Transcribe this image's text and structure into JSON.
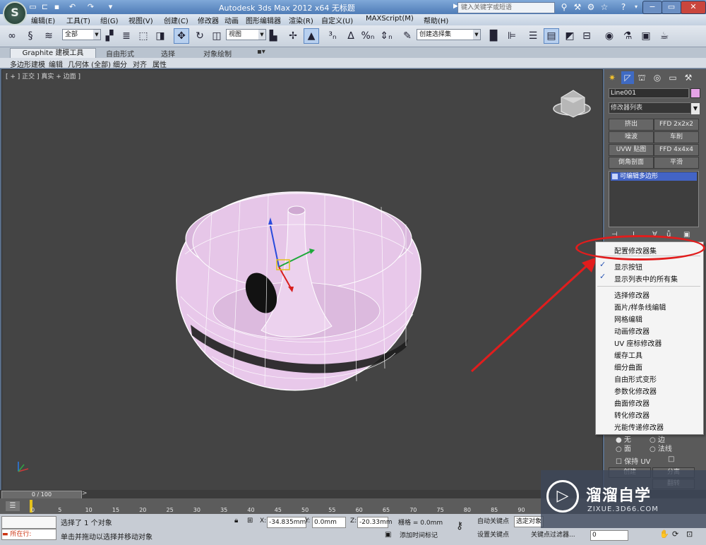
{
  "titlebar": {
    "title": "Autodesk 3ds Max  2012 x64     无标题",
    "search_placeholder": "键入关键字或短语",
    "logo": "S",
    "quick_access_icons": [
      "new-file-icon",
      "open-folder-icon",
      "save-icon",
      "undo-icon",
      "redo-icon",
      "dropdown-icon"
    ]
  },
  "menu": [
    "编辑(E)",
    "工具(T)",
    "组(G)",
    "视图(V)",
    "创建(C)",
    "修改器",
    "动画",
    "图形编辑器",
    "渲染(R)",
    "自定义(U)",
    "MAXScript(M)",
    "帮助(H)"
  ],
  "toolbar": {
    "selection_filter": "全部",
    "reference_coord": "视图",
    "named_selection": "创建选择集"
  },
  "ribbon": {
    "tabs": [
      "Graphite 建模工具",
      "自由形式",
      "选择",
      "对象绘制"
    ],
    "subtabs": [
      "多边形建模",
      "编辑",
      "几何体 (全部)",
      "细分",
      "对齐",
      "属性"
    ]
  },
  "viewport": {
    "label": "[ + ] 正交 ] 真实 + 边面 ]",
    "object_color": "#e8c8ea",
    "wire_color": "#ffffff"
  },
  "command_panel": {
    "object_name": "Line001",
    "object_color": "#e5a3e6",
    "modifier_list": "修改器列表",
    "modifier_buttons": [
      "挤出",
      "FFD 2x2x2",
      "噪波",
      "车削",
      "UVW 贴图",
      "FFD 4x4x4",
      "倒角剖面",
      "平滑"
    ],
    "stack_item": "可编辑多边形",
    "radio_options": [
      "无",
      "边",
      "面",
      "法线"
    ],
    "preserve_uv": "保持 UV",
    "btn_attach": "创建",
    "btn_split": "分离",
    "btn_flip": "翻转"
  },
  "context_menu": {
    "items": [
      {
        "label": "配置修改器集",
        "checked": false
      },
      {
        "label": "显示按钮",
        "checked": true
      },
      {
        "label": "显示列表中的所有集",
        "checked": true
      },
      {
        "label": "选择修改器",
        "checked": false
      },
      {
        "label": "面片/样条线编辑",
        "checked": false
      },
      {
        "label": "网格编辑",
        "checked": false
      },
      {
        "label": "动画修改器",
        "checked": false
      },
      {
        "label": "UV 座标修改器",
        "checked": false
      },
      {
        "label": "缓存工具",
        "checked": false
      },
      {
        "label": "细分曲面",
        "checked": false
      },
      {
        "label": "自由形式变形",
        "checked": false
      },
      {
        "label": "参数化修改器",
        "checked": false
      },
      {
        "label": "曲面修改器",
        "checked": false
      },
      {
        "label": "转化修改器",
        "checked": false
      },
      {
        "label": "光能传递修改器",
        "checked": false
      }
    ]
  },
  "timeline": {
    "frame": "0 / 100",
    "ticks": [
      "0",
      "5",
      "10",
      "15",
      "20",
      "25",
      "30",
      "35",
      "40",
      "45",
      "50",
      "55",
      "60",
      "65",
      "70",
      "75",
      "80",
      "85",
      "90"
    ]
  },
  "status": {
    "running_label": "所在行:",
    "selection": "选择了 1 个对象",
    "prompt": "单击并拖动以选择并移动对象",
    "x_label": "X:",
    "x": "-34.835mm",
    "y_label": "Y:",
    "y": "0.0mm",
    "z_label": "Z:",
    "z": "-20.33mm",
    "grid": "栅格 = 0.0mm",
    "add_time_tag": "添加时间标记",
    "auto_key": "自动关键点",
    "selected_obj": "选定对象",
    "set_key": "设置关键点",
    "key_filters": "关键点过滤器...",
    "frame_field": "0"
  },
  "watermark": {
    "name": "溜溜自学",
    "url": "ZIXUE.3D66.COM"
  },
  "annotation_color": "#e11d1d"
}
